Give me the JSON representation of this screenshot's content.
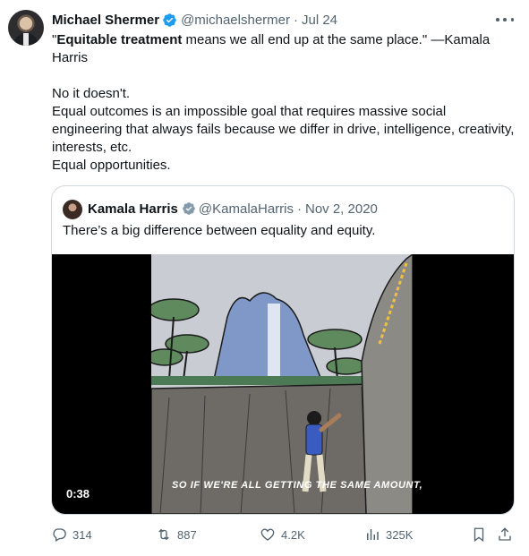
{
  "tweet": {
    "author_name": "Michael Shermer",
    "handle": "@michaelshermer",
    "date_sep": "·",
    "date": "Jul 24",
    "line1_bold": "Equitable treatment",
    "line1_prefix": "\"",
    "line1_rest": " means we all end up at the same place.\" —Kamala Harris",
    "line2": "No it doesn't.",
    "line3": "Equal outcomes is an impossible goal that requires massive social engineering that always fails because we differ in drive, intelligence, creativity, interests, etc.",
    "line4": "Equal opportunities."
  },
  "quote": {
    "author_name": "Kamala Harris",
    "handle": "@KamalaHarris",
    "date_sep": "·",
    "date": "Nov 2, 2020",
    "text": "There’s a big difference between equality and equity.",
    "video": {
      "duration": "0:38",
      "caption": "SO IF WE'RE ALL GETTING THE SAME AMOUNT,"
    }
  },
  "actions": {
    "replies": "314",
    "retweets": "887",
    "likes": "4.2K",
    "views": "325K"
  },
  "icons": {
    "verified": "verified-badge-icon",
    "more": "more-options-icon",
    "reply": "reply-icon",
    "retweet": "retweet-icon",
    "like": "heart-icon",
    "views": "views-chart-icon",
    "bookmark": "bookmark-icon",
    "share": "share-icon"
  },
  "colors": {
    "verified_blue": "#1d9bf0",
    "muted_text": "#536471",
    "border": "#cfd9de"
  }
}
